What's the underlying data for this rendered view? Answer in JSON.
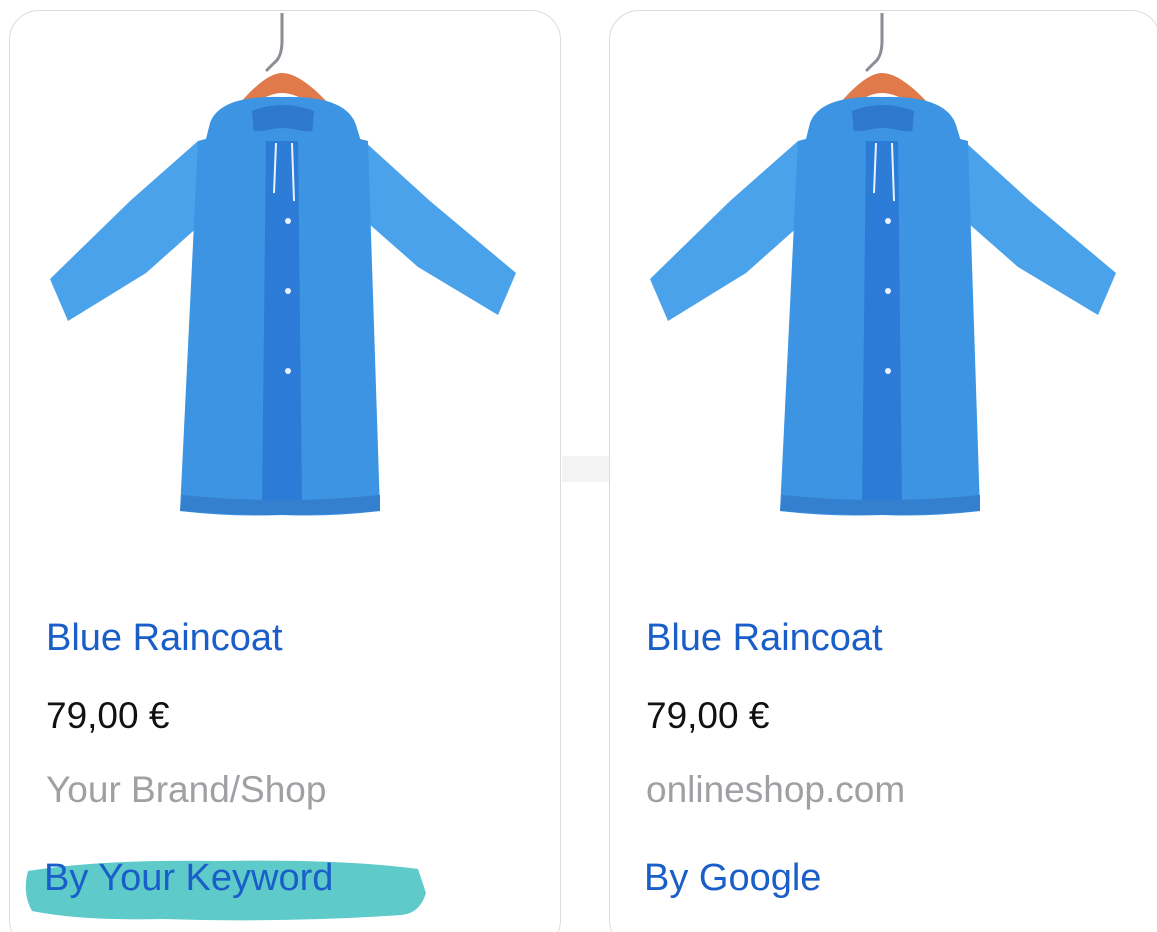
{
  "colors": {
    "title_blue": "#1a5fc9",
    "price": "#111111",
    "shop_gray": "#a0a0a4",
    "highlight_teal": "#4cc4c4",
    "raincoat_blue": "#3c94e3"
  },
  "cards": [
    {
      "image_icon": "blue-raincoat-on-hanger",
      "title": "Blue Raincoat",
      "price": "79,00 €",
      "shop": "Your Brand/Shop",
      "byline": "By Your Keyword",
      "byline_highlighted": true
    },
    {
      "image_icon": "blue-raincoat-on-hanger",
      "title": "Blue Raincoat",
      "price": "79,00 €",
      "shop": "onlineshop.com",
      "byline": "By Google",
      "byline_highlighted": false
    }
  ]
}
